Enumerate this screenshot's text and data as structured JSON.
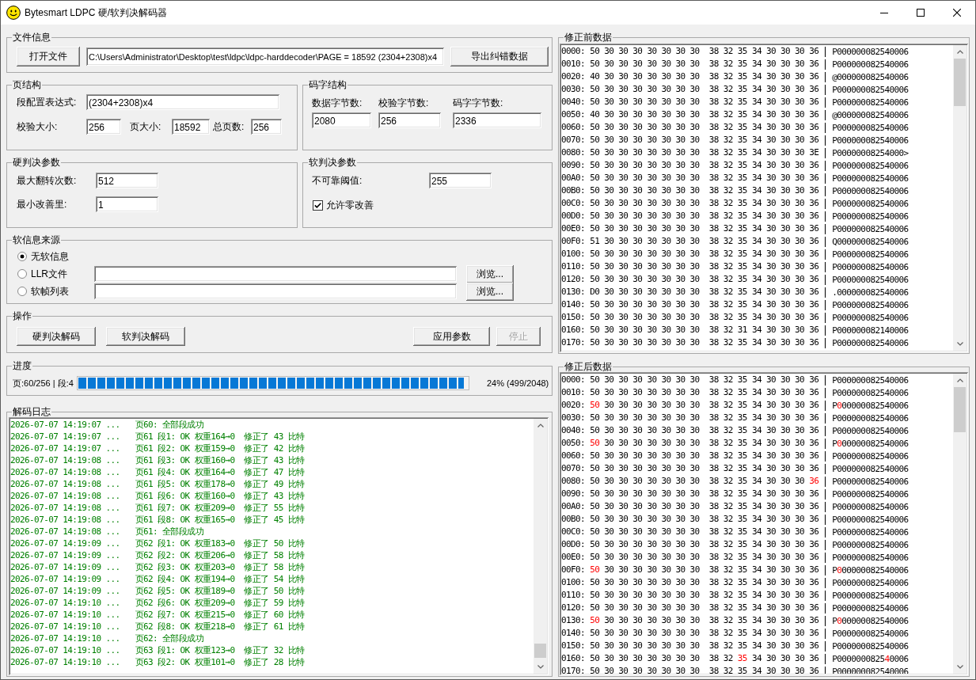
{
  "window": {
    "title": "Bytesmart LDPC 硬/软判决解码器"
  },
  "file_info": {
    "title": "文件信息",
    "open_button": "打开文件",
    "path": "C:\\Users\\Administrator\\Desktop\\test\\ldpc\\ldpc-harddecoder\\PAGE = 18592 (2304+2308)x4",
    "export_button": "导出纠错数据"
  },
  "page_structure": {
    "title": "页结构",
    "expression": {
      "label": "段配置表达式:",
      "value": "(2304+2308)x4"
    },
    "sizes": [
      {
        "label": "校验大小:",
        "value": "256"
      },
      {
        "label": "页大小:",
        "value": "18592"
      },
      {
        "label": "总页数:",
        "value": "256"
      }
    ]
  },
  "codeword_structure": {
    "title": "码字结构",
    "fields": [
      {
        "label": "数据字节数:",
        "value": "2080"
      },
      {
        "label": "校验字节数:",
        "value": "256"
      },
      {
        "label": "码字字节数:",
        "value": "2336"
      }
    ]
  },
  "hard_decision": {
    "title": "硬判决参数",
    "fields": [
      {
        "label": "最大翻转次数:",
        "value": "512"
      },
      {
        "label": "最小改善里:",
        "value": "1"
      }
    ]
  },
  "soft_decision": {
    "title": "软判决参数",
    "threshold": {
      "label": "不可靠阈值:",
      "value": "255"
    },
    "allow_zero": {
      "label": "允许零改善",
      "checked": true
    }
  },
  "soft_source": {
    "title": "软信息来源",
    "options": [
      {
        "kind": "plain",
        "label": "无软信息",
        "selected": true
      },
      {
        "kind": "file",
        "label": "LLR文件",
        "selected": false,
        "browse_button": "浏览..."
      },
      {
        "kind": "file",
        "label": "软帧列表",
        "selected": false,
        "browse_button": "浏览..."
      }
    ]
  },
  "actions": {
    "title": "操作",
    "left_buttons": [
      {
        "label": "硬判决解码",
        "disabled": false
      },
      {
        "label": "软判决解码",
        "disabled": false
      }
    ],
    "right_buttons": [
      {
        "label": "应用参数",
        "disabled": false
      },
      {
        "label": "停止",
        "disabled": true
      }
    ]
  },
  "progress": {
    "title": "进度",
    "position": "页:60/256 | 段:4",
    "level": 0.99,
    "summary": "24% (499/2048)"
  },
  "log": {
    "title": "解码日志",
    "entries": [
      {
        "time": "2026-07-07 14:19:07 ...",
        "message": "页60: 全部段成功"
      },
      {
        "time": "2026-07-07 14:19:07 ...",
        "message": "页61 段1: OK 权重164→0  修正了 43 比特"
      },
      {
        "time": "2026-07-07 14:19:07 ...",
        "message": "页61 段2: OK 权重159→0  修正了 42 比特"
      },
      {
        "time": "2026-07-07 14:19:08 ...",
        "message": "页61 段3: OK 权重160→0  修正了 43 比特"
      },
      {
        "time": "2026-07-07 14:19:08 ...",
        "message": "页61 段4: OK 权重164→0  修正了 47 比特"
      },
      {
        "time": "2026-07-07 14:19:08 ...",
        "message": "页61 段5: OK 权重178→0  修正了 49 比特"
      },
      {
        "time": "2026-07-07 14:19:08 ...",
        "message": "页61 段6: OK 权重160→0  修正了 43 比特"
      },
      {
        "time": "2026-07-07 14:19:08 ...",
        "message": "页61 段7: OK 权重209→0  修正了 55 比特"
      },
      {
        "time": "2026-07-07 14:19:08 ...",
        "message": "页61 段8: OK 权重165→0  修正了 45 比特"
      },
      {
        "time": "2026-07-07 14:19:08 ...",
        "message": "页61: 全部段成功"
      },
      {
        "time": "2026-07-07 14:19:09 ...",
        "message": "页62 段1: OK 权重183→0  修正了 50 比特"
      },
      {
        "time": "2026-07-07 14:19:09 ...",
        "message": "页62 段2: OK 权重206→0  修正了 58 比特"
      },
      {
        "time": "2026-07-07 14:19:09 ...",
        "message": "页62 段3: OK 权重203→0  修正了 58 比特"
      },
      {
        "time": "2026-07-07 14:19:09 ...",
        "message": "页62 段4: OK 权重194→0  修正了 54 比特"
      },
      {
        "time": "2026-07-07 14:19:09 ...",
        "message": "页62 段5: OK 权重189→0  修正了 50 比特"
      },
      {
        "time": "2026-07-07 14:19:10 ...",
        "message": "页62 段6: OK 权重209→0  修正了 59 比特"
      },
      {
        "time": "2026-07-07 14:19:10 ...",
        "message": "页62 段7: OK 权重215→0  修正了 60 比特"
      },
      {
        "time": "2026-07-07 14:19:10 ...",
        "message": "页62 段8: OK 权重218→0  修正了 61 比特"
      },
      {
        "time": "2026-07-07 14:19:10 ...",
        "message": "页62: 全部段成功"
      },
      {
        "time": "2026-07-07 14:19:10 ...",
        "message": "页63 段1: OK 权重123→0  修正了 32 比特"
      },
      {
        "time": "2026-07-07 14:19:10 ...",
        "message": "页63 段2: OK 权重101→0  修正了 28 比特"
      }
    ]
  },
  "data_before": {
    "title": "修正前数据",
    "rows": [
      {
        "offset": "0000:",
        "hex": [
          {
            "text": "50 30 30 30 30 30 30 30  38 32 35 34 30 30 30 36",
            "changed": false
          }
        ],
        "ascii": [
          {
            "text": "P000000082540006",
            "changed": false
          }
        ]
      },
      {
        "offset": "0010:",
        "hex": [
          {
            "text": "50 30 30 30 30 30 30 30  38 32 35 34 30 30 30 36",
            "changed": false
          }
        ],
        "ascii": [
          {
            "text": "P000000082540006",
            "changed": false
          }
        ]
      },
      {
        "offset": "0020:",
        "hex": [
          {
            "text": "40 30 30 30 30 30 30 30  38 32 35 34 30 30 30 36",
            "changed": false
          }
        ],
        "ascii": [
          {
            "text": "@000000082540006",
            "changed": false
          }
        ]
      },
      {
        "offset": "0030:",
        "hex": [
          {
            "text": "50 30 30 30 30 30 30 30  38 32 35 34 30 30 30 36",
            "changed": false
          }
        ],
        "ascii": [
          {
            "text": "P000000082540006",
            "changed": false
          }
        ]
      },
      {
        "offset": "0040:",
        "hex": [
          {
            "text": "50 30 30 30 30 30 30 30  38 32 35 34 30 30 30 36",
            "changed": false
          }
        ],
        "ascii": [
          {
            "text": "P000000082540006",
            "changed": false
          }
        ]
      },
      {
        "offset": "0050:",
        "hex": [
          {
            "text": "40 30 30 30 30 30 30 30  38 32 35 34 30 30 30 36",
            "changed": false
          }
        ],
        "ascii": [
          {
            "text": "@000000082540006",
            "changed": false
          }
        ]
      },
      {
        "offset": "0060:",
        "hex": [
          {
            "text": "50 30 30 30 30 30 30 30  38 32 35 34 30 30 30 36",
            "changed": false
          }
        ],
        "ascii": [
          {
            "text": "P000000082540006",
            "changed": false
          }
        ]
      },
      {
        "offset": "0070:",
        "hex": [
          {
            "text": "50 30 30 30 30 30 30 30  38 32 35 34 30 30 30 36",
            "changed": false
          }
        ],
        "ascii": [
          {
            "text": "P000000082540006",
            "changed": false
          }
        ]
      },
      {
        "offset": "0080:",
        "hex": [
          {
            "text": "50 30 30 30 30 30 30 30  38 32 35 34 30 30 30 3E",
            "changed": false
          }
        ],
        "ascii": [
          {
            "text": "P00000008254000>",
            "changed": false
          }
        ]
      },
      {
        "offset": "0090:",
        "hex": [
          {
            "text": "50 30 30 30 30 30 30 30  38 32 35 34 30 30 30 36",
            "changed": false
          }
        ],
        "ascii": [
          {
            "text": "P000000082540006",
            "changed": false
          }
        ]
      },
      {
        "offset": "00A0:",
        "hex": [
          {
            "text": "50 30 30 30 30 30 30 30  38 32 35 34 30 30 30 36",
            "changed": false
          }
        ],
        "ascii": [
          {
            "text": "P000000082540006",
            "changed": false
          }
        ]
      },
      {
        "offset": "00B0:",
        "hex": [
          {
            "text": "50 30 30 30 30 30 30 30  38 32 35 34 30 30 30 36",
            "changed": false
          }
        ],
        "ascii": [
          {
            "text": "P000000082540006",
            "changed": false
          }
        ]
      },
      {
        "offset": "00C0:",
        "hex": [
          {
            "text": "50 30 30 30 30 30 30 30  38 32 35 34 30 30 30 36",
            "changed": false
          }
        ],
        "ascii": [
          {
            "text": "P000000082540006",
            "changed": false
          }
        ]
      },
      {
        "offset": "00D0:",
        "hex": [
          {
            "text": "50 30 30 30 30 30 30 30  38 32 35 34 30 30 30 36",
            "changed": false
          }
        ],
        "ascii": [
          {
            "text": "P000000082540006",
            "changed": false
          }
        ]
      },
      {
        "offset": "00E0:",
        "hex": [
          {
            "text": "50 30 30 30 30 30 30 30  38 32 35 34 30 30 30 36",
            "changed": false
          }
        ],
        "ascii": [
          {
            "text": "P000000082540006",
            "changed": false
          }
        ]
      },
      {
        "offset": "00F0:",
        "hex": [
          {
            "text": "51 30 30 30 30 30 30 30  38 32 35 34 30 30 30 36",
            "changed": false
          }
        ],
        "ascii": [
          {
            "text": "Q000000082540006",
            "changed": false
          }
        ]
      },
      {
        "offset": "0100:",
        "hex": [
          {
            "text": "50 30 30 30 30 30 30 30  38 32 35 34 30 30 30 36",
            "changed": false
          }
        ],
        "ascii": [
          {
            "text": "P000000082540006",
            "changed": false
          }
        ]
      },
      {
        "offset": "0110:",
        "hex": [
          {
            "text": "50 30 30 30 30 30 30 30  38 32 35 34 30 30 30 36",
            "changed": false
          }
        ],
        "ascii": [
          {
            "text": "P000000082540006",
            "changed": false
          }
        ]
      },
      {
        "offset": "0120:",
        "hex": [
          {
            "text": "50 30 30 30 30 30 30 30  38 32 35 34 30 30 30 36",
            "changed": false
          }
        ],
        "ascii": [
          {
            "text": "P000000082540006",
            "changed": false
          }
        ]
      },
      {
        "offset": "0130:",
        "hex": [
          {
            "text": "D0 30 30 30 30 30 30 30  38 32 35 34 30 30 30 36",
            "changed": false
          }
        ],
        "ascii": [
          {
            "text": ".000000082540006",
            "changed": false
          }
        ]
      },
      {
        "offset": "0140:",
        "hex": [
          {
            "text": "50 30 30 30 30 30 30 30  38 32 35 34 30 30 30 36",
            "changed": false
          }
        ],
        "ascii": [
          {
            "text": "P000000082540006",
            "changed": false
          }
        ]
      },
      {
        "offset": "0150:",
        "hex": [
          {
            "text": "50 30 30 30 30 30 30 30  38 32 35 34 30 30 30 36",
            "changed": false
          }
        ],
        "ascii": [
          {
            "text": "P000000082540006",
            "changed": false
          }
        ]
      },
      {
        "offset": "0160:",
        "hex": [
          {
            "text": "50 30 30 30 30 30 30 30  38 32 31 34 30 30 30 36",
            "changed": false
          }
        ],
        "ascii": [
          {
            "text": "P000000082140006",
            "changed": false
          }
        ]
      },
      {
        "offset": "0170:",
        "hex": [
          {
            "text": "50 30 30 30 30 30 30 30  38 32 35 34 30 30 30 36",
            "changed": false
          }
        ],
        "ascii": [
          {
            "text": "P000000082540006",
            "changed": false
          }
        ]
      }
    ]
  },
  "data_after": {
    "title": "修正后数据",
    "rows": [
      {
        "offset": "0000:",
        "hex": [
          {
            "text": "50 30 30 30 30 30 30 30  38 32 35 34 30 30 30 36",
            "changed": false
          }
        ],
        "ascii": [
          {
            "text": "P000000082540006",
            "changed": false
          }
        ]
      },
      {
        "offset": "0010:",
        "hex": [
          {
            "text": "50 30 30 30 30 30 30 30  38 32 35 34 30 30 30 36",
            "changed": false
          }
        ],
        "ascii": [
          {
            "text": "P000000082540006",
            "changed": false
          }
        ]
      },
      {
        "offset": "0020:",
        "hex": [
          {
            "text": "50",
            "changed": true
          },
          {
            "text": "30 30 30 30 30 30 30  38 32 35 34 30 30 30 36",
            "changed": false
          }
        ],
        "ascii": [
          {
            "text": "P",
            "changed": false
          },
          {
            "text": "0",
            "changed": true
          },
          {
            "text": "00000082540006",
            "changed": false
          }
        ]
      },
      {
        "offset": "0030:",
        "hex": [
          {
            "text": "50 30 30 30 30 30 30 30  38 32 35 34 30 30 30 36",
            "changed": false
          }
        ],
        "ascii": [
          {
            "text": "P000000082540006",
            "changed": false
          }
        ]
      },
      {
        "offset": "0040:",
        "hex": [
          {
            "text": "50 30 30 30 30 30 30 30  38 32 35 34 30 30 30 36",
            "changed": false
          }
        ],
        "ascii": [
          {
            "text": "P000000082540006",
            "changed": false
          }
        ]
      },
      {
        "offset": "0050:",
        "hex": [
          {
            "text": "50",
            "changed": true
          },
          {
            "text": "30 30 30 30 30 30 30  38 32 35 34 30 30 30 36",
            "changed": false
          }
        ],
        "ascii": [
          {
            "text": "P",
            "changed": false
          },
          {
            "text": "0",
            "changed": true
          },
          {
            "text": "00000082540006",
            "changed": false
          }
        ]
      },
      {
        "offset": "0060:",
        "hex": [
          {
            "text": "50 30 30 30 30 30 30 30  38 32 35 34 30 30 30 36",
            "changed": false
          }
        ],
        "ascii": [
          {
            "text": "P000000082540006",
            "changed": false
          }
        ]
      },
      {
        "offset": "0070:",
        "hex": [
          {
            "text": "50 30 30 30 30 30 30 30  38 32 35 34 30 30 30 36",
            "changed": false
          }
        ],
        "ascii": [
          {
            "text": "P000000082540006",
            "changed": false
          }
        ]
      },
      {
        "offset": "0080:",
        "hex": [
          {
            "text": "50 30 30 30 30 30 30 30  38 32 35 34 30 30 30",
            "changed": false
          },
          {
            "text": "36",
            "changed": true
          }
        ],
        "ascii": [
          {
            "text": "P000000082540006",
            "changed": false
          }
        ]
      },
      {
        "offset": "0090:",
        "hex": [
          {
            "text": "50 30 30 30 30 30 30 30  38 32 35 34 30 30 30 36",
            "changed": false
          }
        ],
        "ascii": [
          {
            "text": "P000000082540006",
            "changed": false
          }
        ]
      },
      {
        "offset": "00A0:",
        "hex": [
          {
            "text": "50 30 30 30 30 30 30 30  38 32 35 34 30 30 30 36",
            "changed": false
          }
        ],
        "ascii": [
          {
            "text": "P000000082540006",
            "changed": false
          }
        ]
      },
      {
        "offset": "00B0:",
        "hex": [
          {
            "text": "50 30 30 30 30 30 30 30  38 32 35 34 30 30 30 36",
            "changed": false
          }
        ],
        "ascii": [
          {
            "text": "P000000082540006",
            "changed": false
          }
        ]
      },
      {
        "offset": "00C0:",
        "hex": [
          {
            "text": "50 30 30 30 30 30 30 30  38 32 35 34 30 30 30 36",
            "changed": false
          }
        ],
        "ascii": [
          {
            "text": "P000000082540006",
            "changed": false
          }
        ]
      },
      {
        "offset": "00D0:",
        "hex": [
          {
            "text": "50 30 30 30 30 30 30 30  38 32 35 34 30 30 30 36",
            "changed": false
          }
        ],
        "ascii": [
          {
            "text": "P000000082540006",
            "changed": false
          }
        ]
      },
      {
        "offset": "00E0:",
        "hex": [
          {
            "text": "50 30 30 30 30 30 30 30  38 32 35 34 30 30 30 36",
            "changed": false
          }
        ],
        "ascii": [
          {
            "text": "P000000082540006",
            "changed": false
          }
        ]
      },
      {
        "offset": "00F0:",
        "hex": [
          {
            "text": "50",
            "changed": true
          },
          {
            "text": "30 30 30 30 30 30 30  38 32 35 34 30 30 30 36",
            "changed": false
          }
        ],
        "ascii": [
          {
            "text": "P",
            "changed": false
          },
          {
            "text": "0",
            "changed": true
          },
          {
            "text": "00000082540006",
            "changed": false
          }
        ]
      },
      {
        "offset": "0100:",
        "hex": [
          {
            "text": "50 30 30 30 30 30 30 30  38 32 35 34 30 30 30 36",
            "changed": false
          }
        ],
        "ascii": [
          {
            "text": "P000000082540006",
            "changed": false
          }
        ]
      },
      {
        "offset": "0110:",
        "hex": [
          {
            "text": "50 30 30 30 30 30 30 30  38 32 35 34 30 30 30 36",
            "changed": false
          }
        ],
        "ascii": [
          {
            "text": "P000000082540006",
            "changed": false
          }
        ]
      },
      {
        "offset": "0120:",
        "hex": [
          {
            "text": "50 30 30 30 30 30 30 30  38 32 35 34 30 30 30 36",
            "changed": false
          }
        ],
        "ascii": [
          {
            "text": "P000000082540006",
            "changed": false
          }
        ]
      },
      {
        "offset": "0130:",
        "hex": [
          {
            "text": "50",
            "changed": true
          },
          {
            "text": "30 30 30 30 30 30 30  38 32 35 34 30 30 30 36",
            "changed": false
          }
        ],
        "ascii": [
          {
            "text": "P",
            "changed": false
          },
          {
            "text": "0",
            "changed": true
          },
          {
            "text": "00000082540006",
            "changed": false
          }
        ]
      },
      {
        "offset": "0140:",
        "hex": [
          {
            "text": "50 30 30 30 30 30 30 30  38 32 35 34 30 30 30 36",
            "changed": false
          }
        ],
        "ascii": [
          {
            "text": "P000000082540006",
            "changed": false
          }
        ]
      },
      {
        "offset": "0150:",
        "hex": [
          {
            "text": "50 30 30 30 30 30 30 30  38 32 35 34 30 30 30 36",
            "changed": false
          }
        ],
        "ascii": [
          {
            "text": "P000000082540006",
            "changed": false
          }
        ]
      },
      {
        "offset": "0160:",
        "hex": [
          {
            "text": "50 30 30 30 30 30 30 30  38 32",
            "changed": false
          },
          {
            "text": "35",
            "changed": true
          },
          {
            "text": "34 30 30 30 36",
            "changed": false
          }
        ],
        "ascii": [
          {
            "text": "P0000000825",
            "changed": false
          },
          {
            "text": "4",
            "changed": true
          },
          {
            "text": "0006",
            "changed": false
          }
        ]
      },
      {
        "offset": "0170:",
        "hex": [
          {
            "text": "50 30 30 30 30 30 30 30  38 32 35 34 30 30 30 36",
            "changed": false
          }
        ],
        "ascii": [
          {
            "text": "P000000082540006",
            "changed": false
          }
        ]
      }
    ]
  }
}
